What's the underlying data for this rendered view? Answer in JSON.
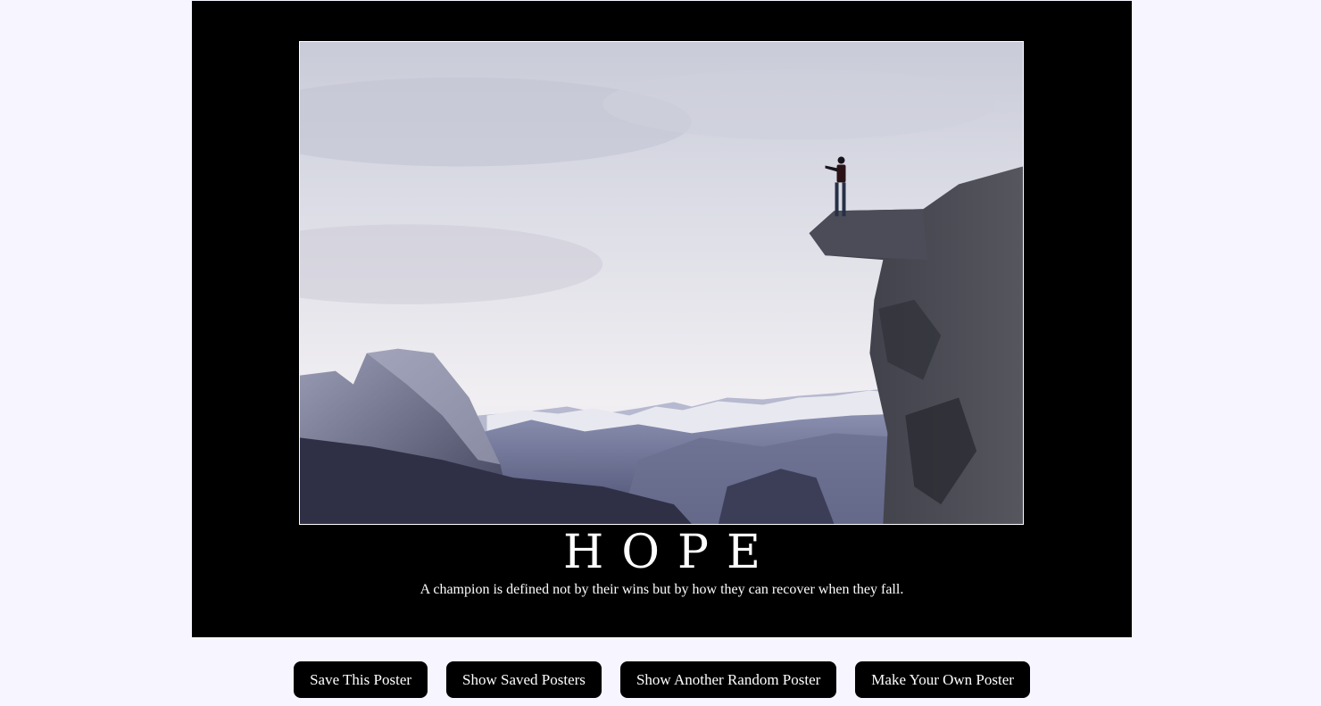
{
  "poster": {
    "image_alt": "climber on cliff edge overlooking Half Dome",
    "title": "HOPE",
    "quote": "A champion is defined not by their wins but by how they can recover when they fall."
  },
  "buttons": {
    "save": "Save This Poster",
    "show_saved": "Show Saved Posters",
    "random": "Show Another Random Poster",
    "make_own": "Make Your Own Poster"
  },
  "colors": {
    "page_background": "#f7f5ff",
    "poster_background": "#000000",
    "button_background": "#000000",
    "text_on_dark": "#ffffff"
  }
}
